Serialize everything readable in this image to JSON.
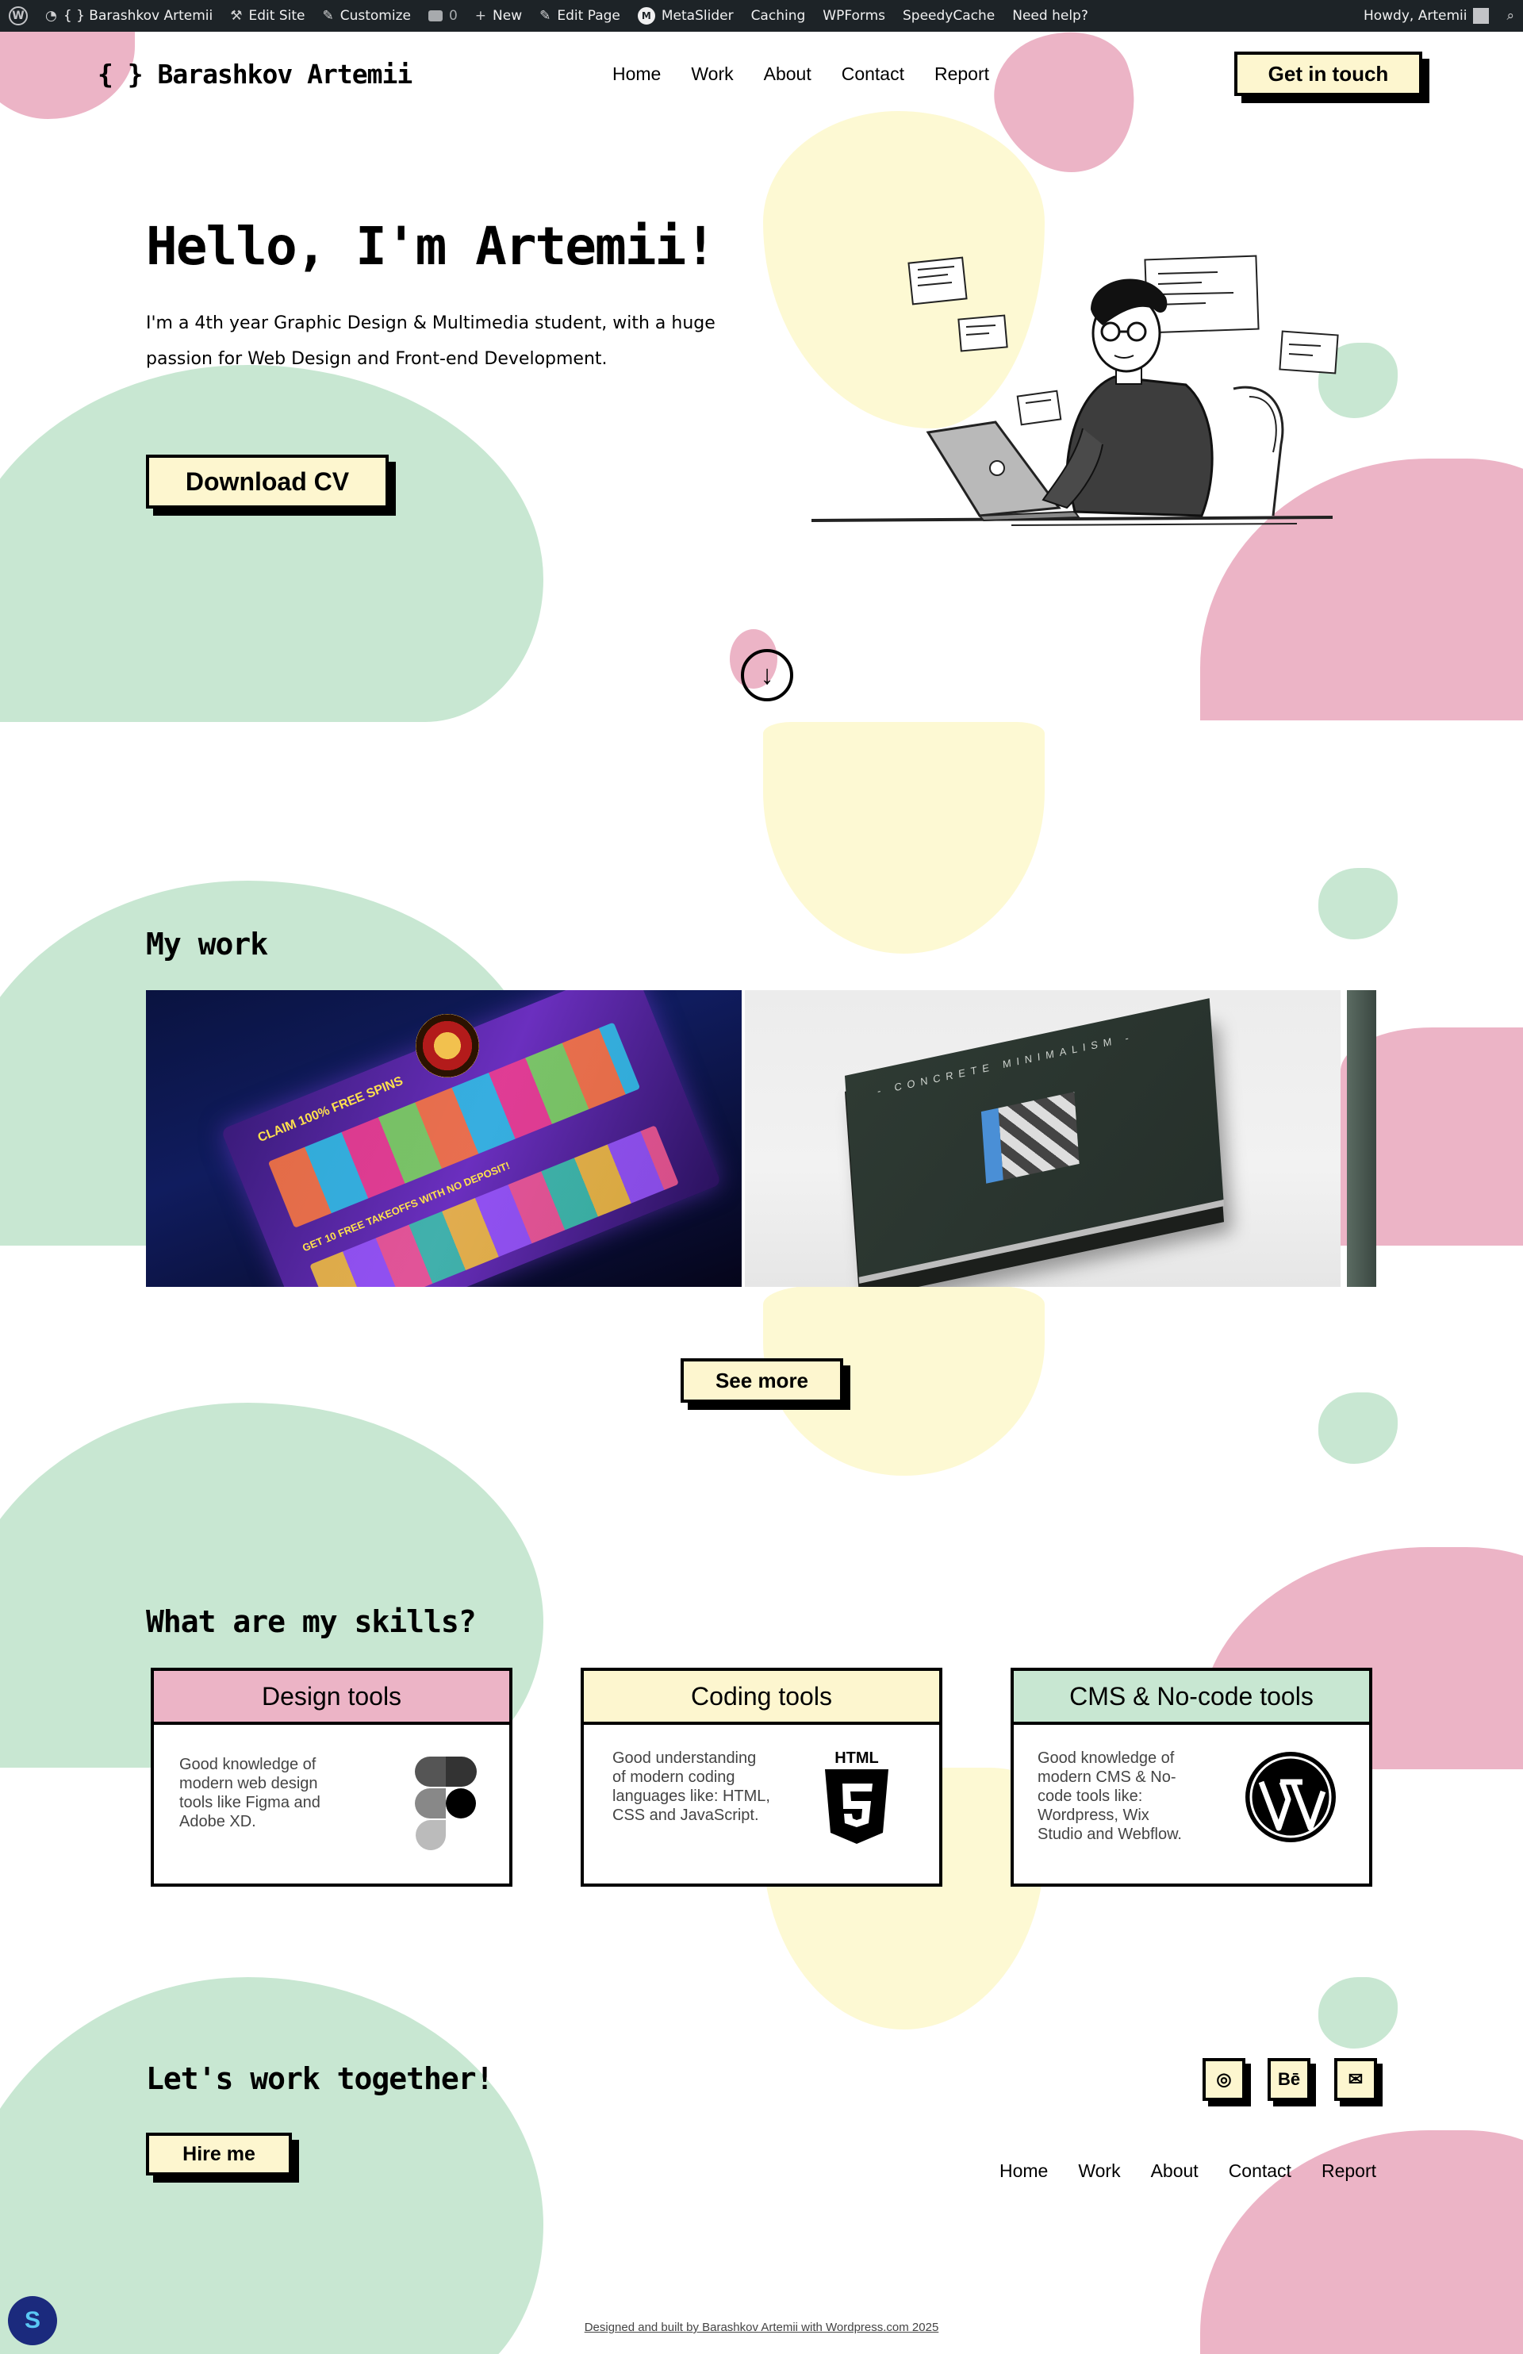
{
  "adminbar": {
    "site": "{ } Barashkov Artemii",
    "edit_site": "Edit Site",
    "customize": "Customize",
    "comments_count": "0",
    "new": "New",
    "edit_page": "Edit Page",
    "metaslider": "MetaSlider",
    "caching": "Caching",
    "wpforms": "WPForms",
    "speedycache": "SpeedyCache",
    "help": "Need help?",
    "howdy": "Howdy, Artemii"
  },
  "header": {
    "logo": "{ } Barashkov Artemii",
    "nav": [
      "Home",
      "Work",
      "About",
      "Contact",
      "Report"
    ],
    "cta": "Get in touch"
  },
  "hero": {
    "title": "Hello, I'm Artemii!",
    "text": "I'm a 4th year Graphic Design & Multimedia student, with a huge passion for Web Design and Front-end Development.",
    "button": "Download CV"
  },
  "work": {
    "title": "My work",
    "book_title": "- CONCRETE  MINIMALISM -",
    "casino_banner_1": "CLAIM 100% FREE SPINS",
    "casino_banner_2": "GET 10 FREE TAKEOFFS WITH NO DEPOSIT!",
    "see_more": "See more"
  },
  "skills": {
    "title": "What are my skills?",
    "cards": [
      {
        "title": "Design tools",
        "text": "Good knowledge of modern web design tools like Figma and Adobe XD.",
        "color": "#ecb4c6",
        "icon": "figma-icon"
      },
      {
        "title": "Coding tools",
        "text": "Good understanding of modern coding languages like: HTML, CSS and JavaScript.",
        "color": "#fdf6cf",
        "icon": "html5-icon",
        "icon_label": "HTML"
      },
      {
        "title": "CMS & No-code tools",
        "text": "Good knowledge of modern CMS & No-code tools like: Wordpress, Wix Studio and Webflow.",
        "color": "#c8e7d2",
        "icon": "wordpress-icon"
      }
    ]
  },
  "footer": {
    "title": "Let's work together!",
    "hire": "Hire me",
    "socials": [
      {
        "icon": "instagram-icon",
        "label": "◎"
      },
      {
        "icon": "behance-icon",
        "label": "Bē"
      },
      {
        "icon": "mail-icon",
        "label": "✉"
      }
    ],
    "nav": [
      "Home",
      "Work",
      "About",
      "Contact",
      "Report"
    ],
    "credit": "Designed and built by Barashkov Artemii with Wordpress.com 2025"
  },
  "colors": {
    "pink": "#ecb4c6",
    "green": "#c8e7d2",
    "yellow": "#fdf9d3",
    "button": "#fdf6cf"
  }
}
